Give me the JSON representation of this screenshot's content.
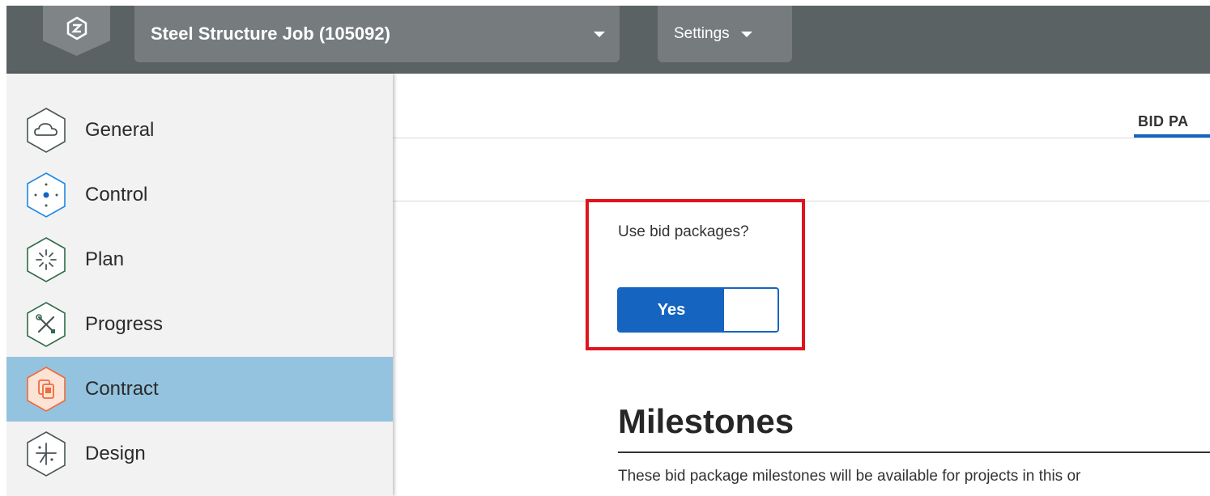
{
  "header": {
    "job_select": {
      "label": "Steel Structure Job (105092)"
    },
    "settings_label": "Settings"
  },
  "sidebar": {
    "items": [
      {
        "label": "General",
        "icon": "cloud-icon"
      },
      {
        "label": "Control",
        "icon": "target-dot-icon"
      },
      {
        "label": "Plan",
        "icon": "burst-icon"
      },
      {
        "label": "Progress",
        "icon": "tools-icon"
      },
      {
        "label": "Contract",
        "icon": "documents-icon",
        "active": true
      },
      {
        "label": "Design",
        "icon": "compass-icon"
      }
    ]
  },
  "main": {
    "tab_label": "BID PA",
    "bid_question": "Use bid packages?",
    "toggle": {
      "on_label": "Yes",
      "value": true
    },
    "milestones": {
      "title": "Milestones",
      "description": "These bid package milestones will be available for projects in this or"
    }
  },
  "colors": {
    "topbar": "#5b6264",
    "accent": "#1565c0",
    "active_nav": "#93c3de",
    "highlight": "#e0141b",
    "contract_icon": "#f06a3c"
  }
}
